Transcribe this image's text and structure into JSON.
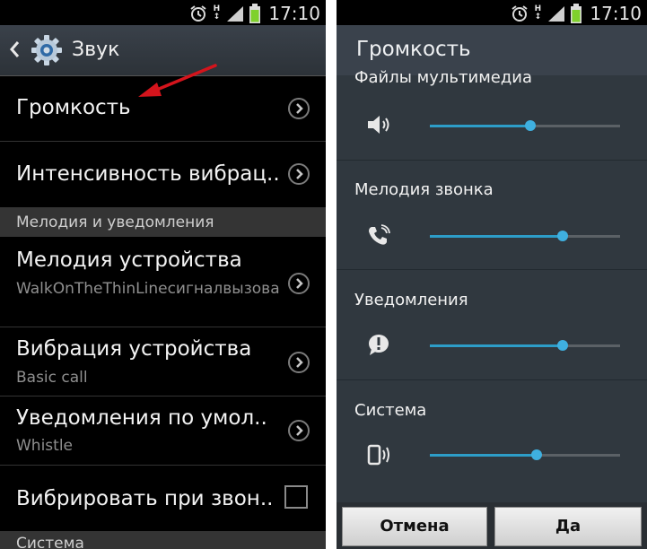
{
  "status": {
    "time": "17:10",
    "network": "H"
  },
  "left": {
    "header": {
      "title": "Звук"
    },
    "rows": [
      {
        "title": "Громкость"
      },
      {
        "title": "Интенсивность вибрац.."
      }
    ],
    "section_ringtones": "Мелодия и уведомления",
    "ring_rows": [
      {
        "title": "Мелодия устройства",
        "subtitle": "WalkOnTheThinLineсигналвызова"
      },
      {
        "title": "Вибрация устройства",
        "subtitle": "Basic call"
      },
      {
        "title": "Уведомления по умол..",
        "subtitle": "Whistle"
      }
    ],
    "vibrate_on_ring": {
      "title": "Вибрировать при звон..",
      "checked": false
    },
    "section_system": "Система"
  },
  "dialog": {
    "title": "Громкость",
    "items": [
      {
        "label": "Файлы мультимедиа",
        "icon": "speaker-icon",
        "level_percent": 53
      },
      {
        "label": "Мелодия звонка",
        "icon": "phone-ring-icon",
        "level_percent": 70
      },
      {
        "label": "Уведомления",
        "icon": "notification-icon",
        "level_percent": 70
      },
      {
        "label": "Система",
        "icon": "phone-vibrate-icon",
        "level_percent": 56
      }
    ],
    "buttons": {
      "cancel": "Отмена",
      "ok": "Да"
    }
  },
  "colors": {
    "accent": "#2d9dc8",
    "annotation_arrow": "#d4141c"
  }
}
